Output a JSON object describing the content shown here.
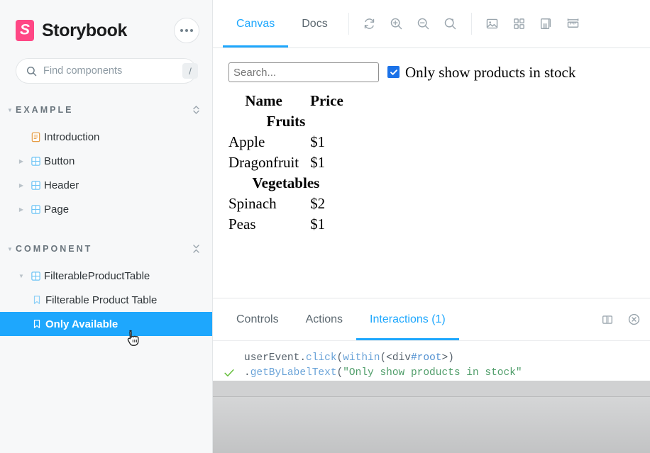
{
  "brand": {
    "name": "Storybook",
    "logo_letter": "S",
    "logo_color": "#FF4785",
    "menu_label": "more-options"
  },
  "search": {
    "placeholder": "Find components",
    "value": "",
    "shortcut": "/"
  },
  "sidebar": {
    "groups": [
      {
        "title": "EXAMPLE",
        "items": [
          {
            "label": "Introduction",
            "icon": "document-icon",
            "expandable": false,
            "selected": false,
            "depth": 1
          },
          {
            "label": "Button",
            "icon": "component-icon",
            "expandable": true,
            "selected": false,
            "depth": 1
          },
          {
            "label": "Header",
            "icon": "component-icon",
            "expandable": true,
            "selected": false,
            "depth": 1
          },
          {
            "label": "Page",
            "icon": "component-icon",
            "expandable": true,
            "selected": false,
            "depth": 1
          }
        ]
      },
      {
        "title": "COMPONENT",
        "items": [
          {
            "label": "FilterableProductTable",
            "icon": "component-icon",
            "expandable": true,
            "selected": false,
            "depth": 1
          },
          {
            "label": "Filterable Product Table",
            "icon": "story-icon",
            "expandable": false,
            "selected": false,
            "depth": 2
          },
          {
            "label": "Only Available",
            "icon": "story-icon",
            "expandable": false,
            "selected": true,
            "depth": 2
          }
        ]
      }
    ]
  },
  "toolbar": {
    "tabs": [
      {
        "label": "Canvas",
        "active": true
      },
      {
        "label": "Docs",
        "active": false
      }
    ],
    "controls": [
      "refresh-icon",
      "zoom-in-icon",
      "zoom-out-icon",
      "zoom-reset-icon"
    ],
    "view_tools": [
      "background-image-icon",
      "grid-icon",
      "layers-icon",
      "measure-icon"
    ],
    "accent_color": "#1EA7FD"
  },
  "canvas": {
    "search_placeholder": "Search...",
    "search_value": "",
    "checkbox_label": "Only show products in stock",
    "checkbox_checked": true,
    "checkbox_color": "#1B72E8",
    "table": {
      "headers": [
        "Name",
        "Price"
      ],
      "rows": [
        {
          "type": "category",
          "label": "Fruits"
        },
        {
          "type": "product",
          "name": "Apple",
          "price": "$1"
        },
        {
          "type": "product",
          "name": "Dragonfruit",
          "price": "$1"
        },
        {
          "type": "category",
          "label": "Vegetables"
        },
        {
          "type": "product",
          "name": "Spinach",
          "price": "$2"
        },
        {
          "type": "product",
          "name": "Peas",
          "price": "$1"
        }
      ]
    }
  },
  "panel": {
    "tabs": [
      {
        "label": "Controls",
        "active": false
      },
      {
        "label": "Actions",
        "active": false
      },
      {
        "label": "Interactions (1)",
        "active": true
      }
    ],
    "actions": [
      "layout-split-icon",
      "close-panel-icon"
    ],
    "interactions": [
      {
        "status": "passed",
        "line1_a": "userEvent.",
        "line1_b": "click",
        "line1_c": "(",
        "line1_d": "within",
        "line1_e": "(<div",
        "line1_f": "#root",
        "line1_g": ">)",
        "line2_a": ".",
        "line2_b": "getByLabelText",
        "line2_c": "(",
        "line2_d": "\"Only show products in stock\"",
        "line3": "))"
      }
    ]
  }
}
